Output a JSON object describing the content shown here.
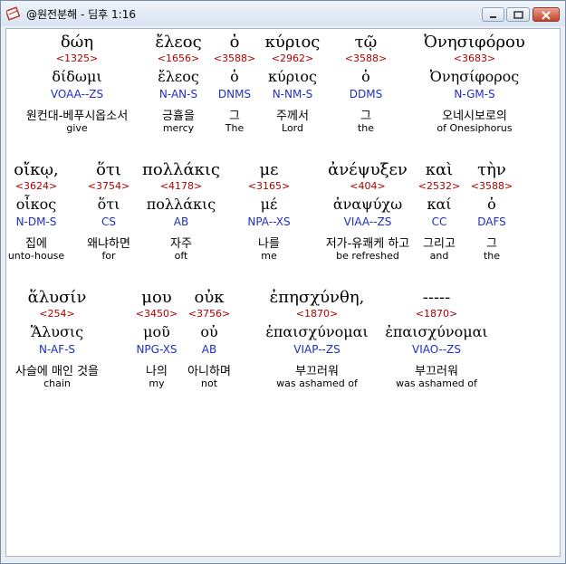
{
  "window": {
    "title": "@원전분해 - 딤후 1:16"
  },
  "rows": [
    [
      {
        "greek": "δώη",
        "strong": "<1325>",
        "lexeme": "δίδωμι",
        "parsing": "VOAA--ZS",
        "korean": "원컨대-베푸시옵소서",
        "english": "give"
      },
      {
        "greek": "ἔλεος",
        "strong": "<1656>",
        "lexeme": "ἔλεος",
        "parsing": "N-AN-S",
        "korean": "긍휼을",
        "english": "mercy"
      },
      {
        "greek": "ὁ",
        "strong": "<3588>",
        "lexeme": "ὁ",
        "parsing": "DNMS",
        "korean": "그",
        "english": "The"
      },
      {
        "greek": "κύριος",
        "strong": "<2962>",
        "lexeme": "κύριος",
        "parsing": "N-NM-S",
        "korean": "주께서",
        "english": "Lord"
      },
      {
        "greek": "τῷ",
        "strong": "<3588>",
        "lexeme": "ὁ",
        "parsing": "DDMS",
        "korean": "그",
        "english": "the"
      },
      {
        "greek": "Ὀνησιφόρου",
        "strong": "<3683>",
        "lexeme": "Ὀνησίφορος",
        "parsing": "N-GM-S",
        "korean": "오네시보로의",
        "english": "of Onesiphorus"
      }
    ],
    [
      {
        "greek": "οἴκῳ,",
        "strong": "<3624>",
        "lexeme": "οἶκος",
        "parsing": "N-DM-S",
        "korean": "집에",
        "english": "unto-house"
      },
      {
        "greek": "ὅτι",
        "strong": "<3754>",
        "lexeme": "ὅτι",
        "parsing": "CS",
        "korean": "왜냐하면",
        "english": "for"
      },
      {
        "greek": "πολλάκις",
        "strong": "<4178>",
        "lexeme": "πολλάκις",
        "parsing": "AB",
        "korean": "자주",
        "english": "oft"
      },
      {
        "greek": "με",
        "strong": "<3165>",
        "lexeme": "μέ",
        "parsing": "NPA--XS",
        "korean": "나를",
        "english": "me"
      },
      {
        "greek": "ἀνέψυξεν",
        "strong": "<404>",
        "lexeme": "ἀναψύχω",
        "parsing": "VIAA--ZS",
        "korean": "저가-유쾌케 하고",
        "english": "be refreshed"
      },
      {
        "greek": "καὶ",
        "strong": "<2532>",
        "lexeme": "καί",
        "parsing": "CC",
        "korean": "그리고",
        "english": "and"
      },
      {
        "greek": "τὴν",
        "strong": "<3588>",
        "lexeme": "ὁ",
        "parsing": "DAFS",
        "korean": "그",
        "english": "the"
      }
    ],
    [
      {
        "greek": "ἅλυσίν",
        "strong": "<254>",
        "lexeme": "Ἅλυσις",
        "parsing": "N-AF-S",
        "korean": "사슬에 매인 것을",
        "english": "chain"
      },
      {
        "greek": "μου",
        "strong": "<3450>",
        "lexeme": "μοῦ",
        "parsing": "NPG-XS",
        "korean": "나의",
        "english": "my"
      },
      {
        "greek": "οὐκ",
        "strong": "<3756>",
        "lexeme": "οὐ",
        "parsing": "AB",
        "korean": "아니하며",
        "english": "not"
      },
      {
        "greek": "ἐπησχύνθη,",
        "strong": "<1870>",
        "lexeme": "ἐπαισχύνομαι",
        "parsing": "VIAP--ZS",
        "korean": "부끄러워",
        "english": "was ashamed of"
      },
      {
        "greek": "-----",
        "strong": "<1870>",
        "lexeme": "ἐπαισχύνομαι",
        "parsing": "VIAO--ZS",
        "korean": "부끄러워",
        "english": "was ashamed of"
      }
    ]
  ]
}
